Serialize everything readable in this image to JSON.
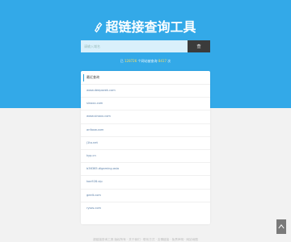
{
  "header": {
    "title": "超链接查询工具",
    "icon": "link-icon"
  },
  "search": {
    "placeholder": "请输入域名",
    "button_label": "查"
  },
  "stats": {
    "prefix": "已",
    "count1": "128726",
    "middle": "个网站被查询",
    "count2": "8417",
    "suffix": "次"
  },
  "panel": {
    "title": "最近查询",
    "items": [
      {
        "label": "www.deepseek.com"
      },
      {
        "label": "sinoxx.com"
      },
      {
        "label": "www.sinoxx.com"
      },
      {
        "label": "anfoxw.com"
      },
      {
        "label": "j1to.net"
      },
      {
        "label": "kyp.cn"
      },
      {
        "label": "b36365.digaming.asia"
      },
      {
        "label": "kov928.vip"
      },
      {
        "label": "geelt.com"
      },
      {
        "label": "",
        "label2": "ryszs.com"
      }
    ]
  },
  "back_to_top": {
    "icon": "arrow-up-icon"
  },
  "footer": {
    "text": "超链接查询工具 版权所有 · 关于我们 · 联系方式 · 友情链接 · 免责声明 · 网站地图"
  },
  "colors": {
    "hero": "#33a9e8",
    "button": "#3b3b3b",
    "accent": "#ffdf5e"
  }
}
